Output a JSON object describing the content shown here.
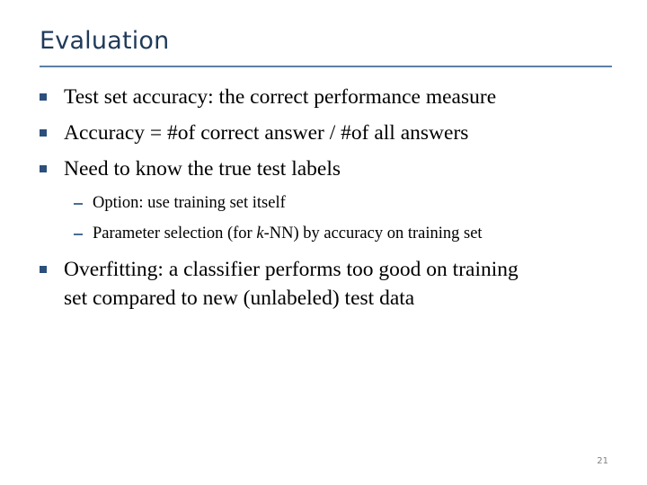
{
  "slide": {
    "title": "Evaluation",
    "bullets": [
      {
        "text": "Test set accuracy: the correct performance measure"
      },
      {
        "text": "Accuracy =  #of correct answer / #of all answers"
      },
      {
        "text": "Need to know the true test labels"
      }
    ],
    "sub_bullets": [
      {
        "text": "Option: use training set itself"
      },
      {
        "pre": "Parameter selection (for ",
        "italic": "k",
        "post": "-NN) by accuracy on training set"
      }
    ],
    "overfitting": {
      "line1": "Overfitting: a classifier performs too good on training",
      "line2": "set compared to new (unlabeled) test data"
    },
    "page_number": "21"
  },
  "colors": {
    "title": "#1f3a5a",
    "rule": "#5b7fa6",
    "bullet": "#2c4f7c",
    "dash": "#4a6d96"
  }
}
